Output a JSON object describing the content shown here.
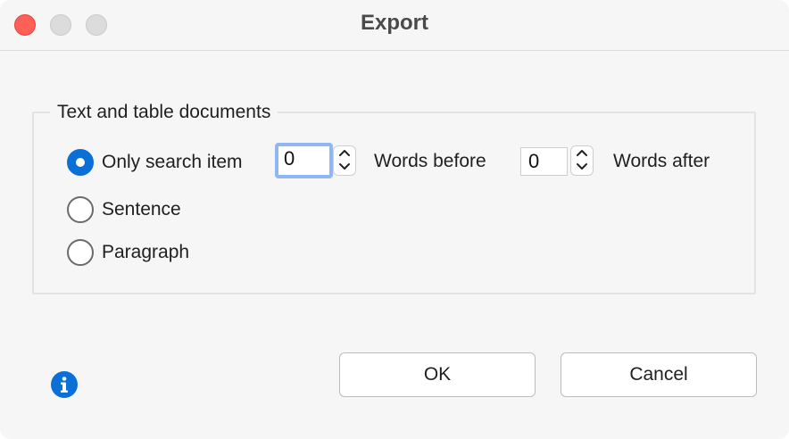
{
  "window": {
    "title": "Export"
  },
  "group": {
    "label": "Text and table documents"
  },
  "options": {
    "only_search_item": "Only search item",
    "sentence": "Sentence",
    "paragraph": "Paragraph",
    "selected": "Only search item"
  },
  "words_before": {
    "value": "0",
    "label": "Words before"
  },
  "words_after": {
    "value": "0",
    "label": "Words after"
  },
  "buttons": {
    "ok": "OK",
    "cancel": "Cancel"
  },
  "icons": {
    "info": "info-icon",
    "up": "chevron-up-icon",
    "down": "chevron-down-icon"
  },
  "colors": {
    "accent": "#0a6fd6",
    "close": "#fe5f57",
    "focus_ring": "#8db8f4"
  }
}
